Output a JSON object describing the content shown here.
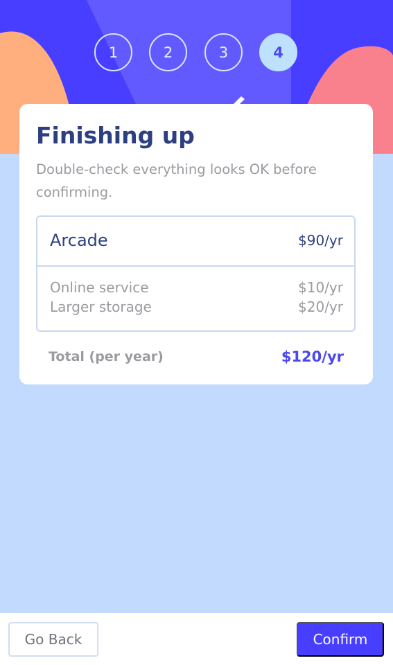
{
  "steps": [
    {
      "number": "1",
      "active": false
    },
    {
      "number": "2",
      "active": false
    },
    {
      "number": "3",
      "active": false
    },
    {
      "number": "4",
      "active": true
    }
  ],
  "card": {
    "title": "Finishing up",
    "subtitle": "Double-check everything looks OK before confirming."
  },
  "summary": {
    "plan": {
      "name": "Arcade",
      "price": "$90/yr"
    },
    "addons": [
      {
        "name": "Online service",
        "price": "$10/yr"
      },
      {
        "name": "Larger storage",
        "price": "$20/yr"
      }
    ]
  },
  "total": {
    "label": "Total (per year)",
    "value": "$120/yr"
  },
  "footer": {
    "back_label": "Go Back",
    "confirm_label": "Confirm"
  },
  "colors": {
    "primary": "#483eff",
    "marine_blue": "#2d3f82",
    "light_blue": "#c1dafe",
    "cool_gray": "#9a9aa0",
    "orange_blob": "#ffaf7e",
    "pink_blob": "#f9818e"
  }
}
